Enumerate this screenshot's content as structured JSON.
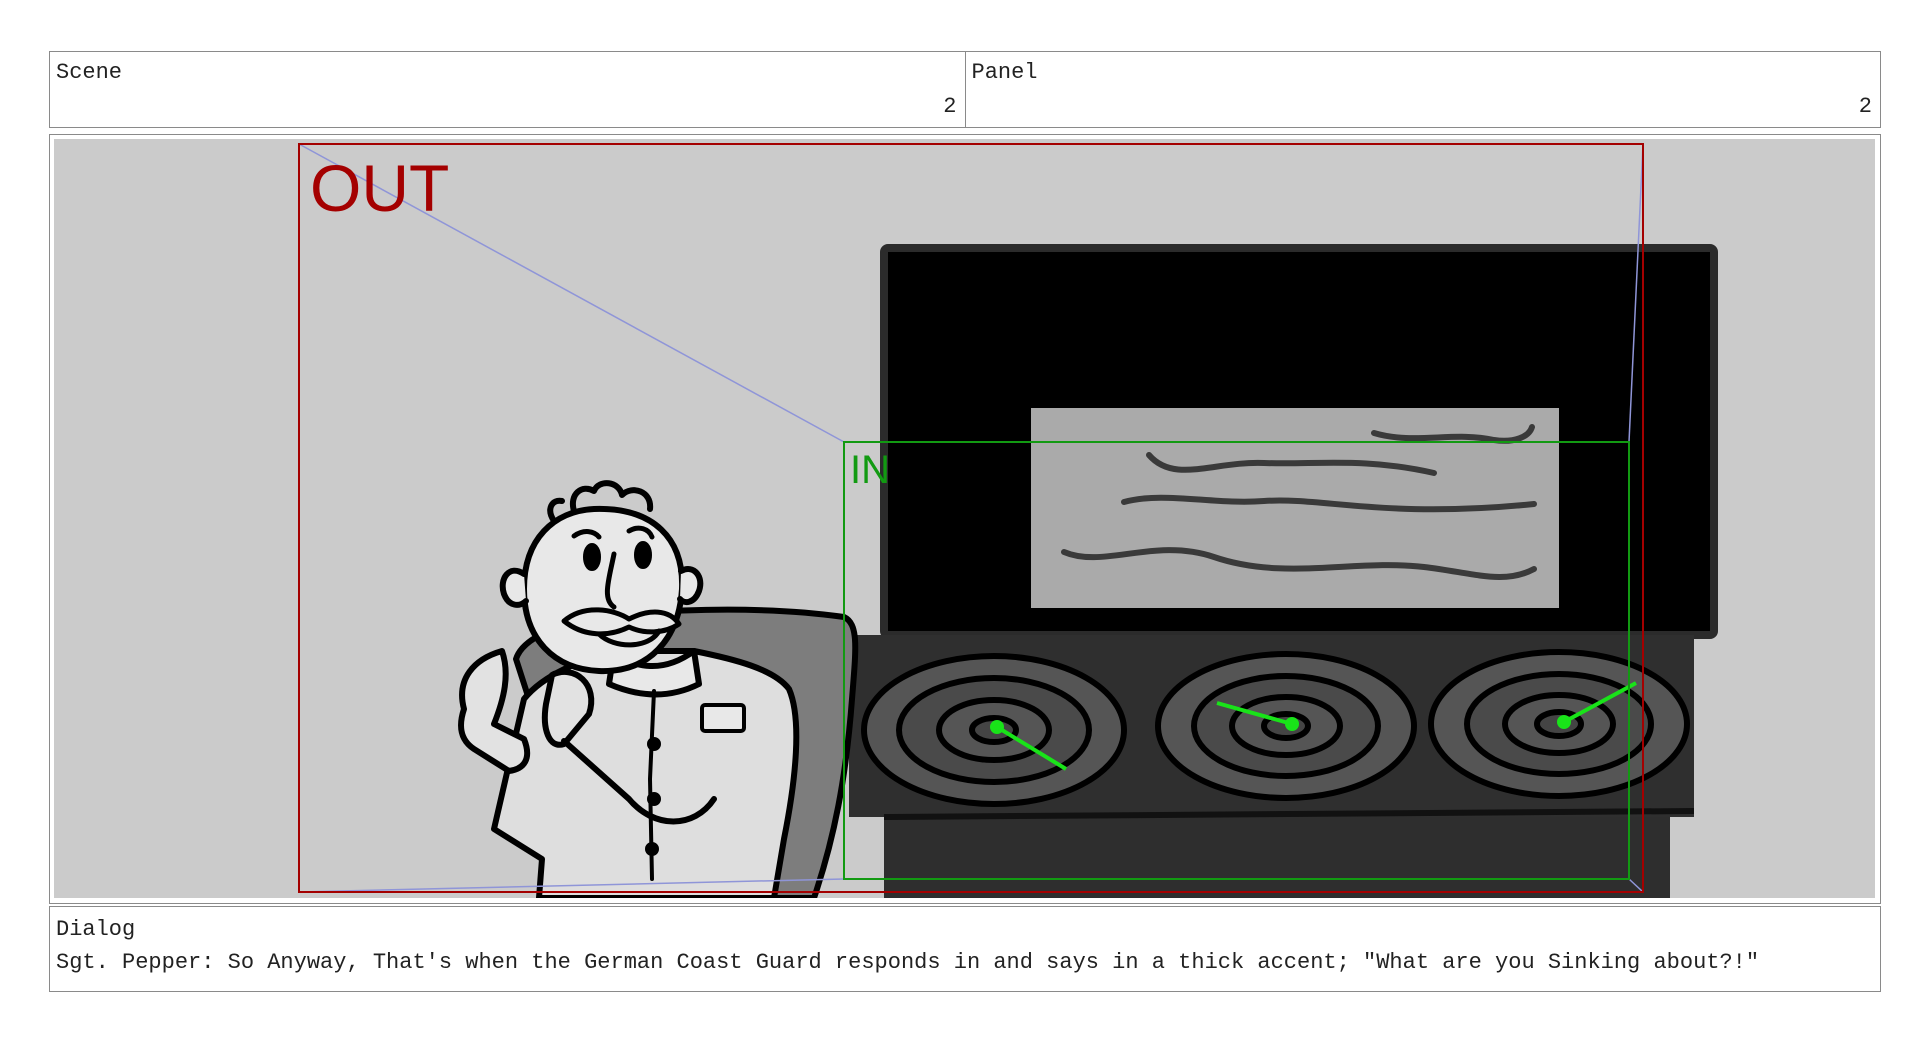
{
  "header": {
    "scene_label": "Scene",
    "scene_value": "2",
    "panel_label": "Panel",
    "panel_value": "2"
  },
  "frame_marks": {
    "out_label": "OUT",
    "in_label": "IN",
    "out_color": "#a40000",
    "in_color": "#129a12",
    "motion_path_color": "#8f95d8"
  },
  "dialog": {
    "label": "Dialog",
    "text": "Sgt. Pepper: So Anyway,  That's when the German Coast Guard responds in and says in a thick accent; \"What are you Sinking about?!\""
  }
}
